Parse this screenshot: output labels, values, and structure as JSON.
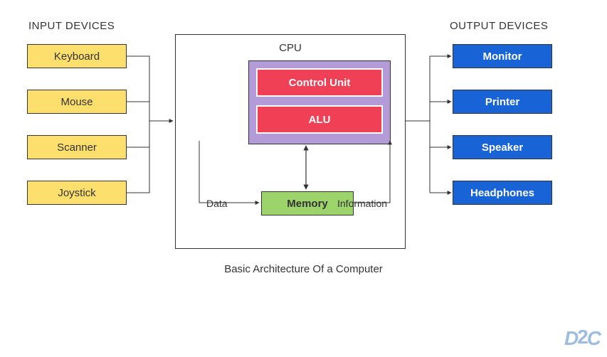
{
  "titles": {
    "input": "INPUT DEVICES",
    "output": "OUTPUT DEVICES",
    "cpu": "CPU",
    "caption": "Basic Architecture Of a Computer"
  },
  "input_devices": [
    "Keyboard",
    "Mouse",
    "Scanner",
    "Joystick"
  ],
  "output_devices": [
    "Monitor",
    "Printer",
    "Speaker",
    "Headphones"
  ],
  "cpu": {
    "control_unit": "Control Unit",
    "alu": "ALU"
  },
  "memory": "Memory",
  "labels": {
    "data": "Data",
    "information": "Information"
  },
  "logo": "D2C",
  "colors": {
    "input_bg": "#fddf6d",
    "output_bg": "#1863d6",
    "cpu_outer": "#b39bd8",
    "cpu_inner": "#ef4056",
    "memory_bg": "#9cd36a"
  }
}
